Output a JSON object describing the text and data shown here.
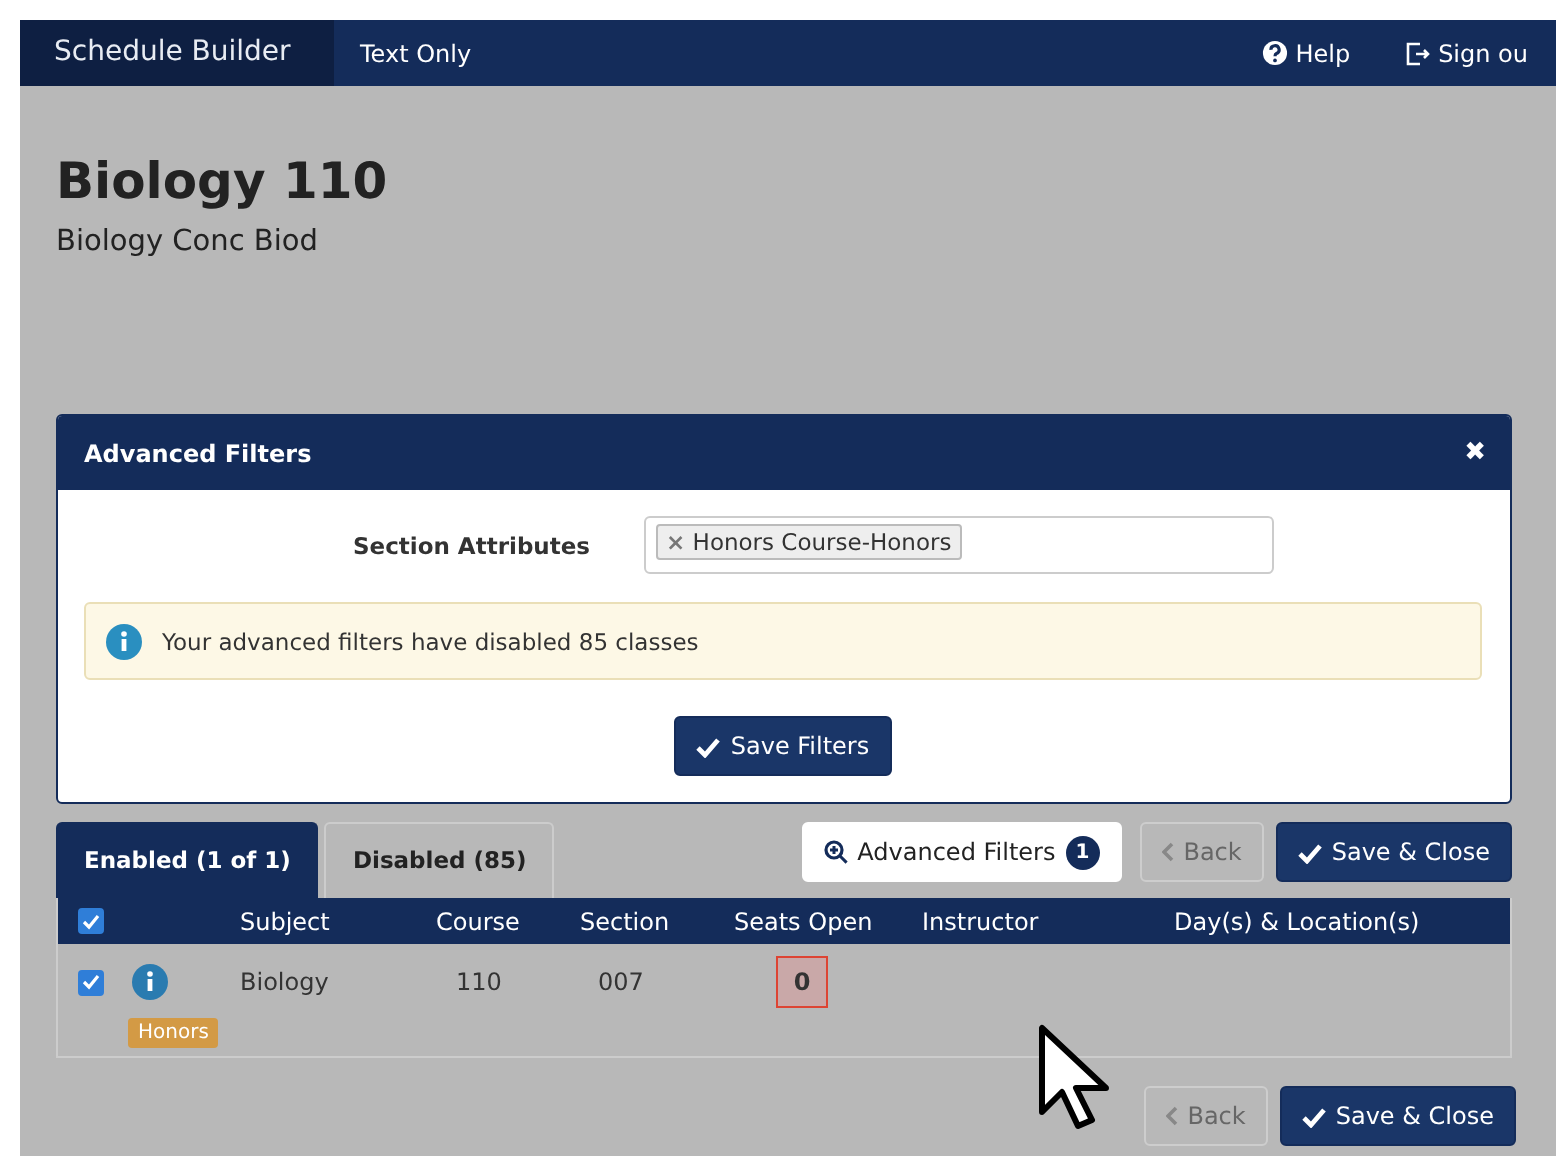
{
  "navbar": {
    "brand": "Schedule Builder",
    "links": [
      {
        "label": "Text Only"
      }
    ],
    "right_links": [
      {
        "label": "Help",
        "kind": "help"
      },
      {
        "label": "Sign ou",
        "kind": "signout"
      }
    ]
  },
  "course": {
    "title": "Biology 110",
    "subtitle": "Biology Conc Biod"
  },
  "modal": {
    "title": "Advanced Filters",
    "close": "✖",
    "field_label": "Section Attributes",
    "tags": [
      {
        "label": "Honors Course-Honors",
        "remove": "×"
      }
    ],
    "alert": "Your advanced filters have disabled 85 classes",
    "save_button": "Save Filters"
  },
  "tabs": [
    {
      "label": "Enabled (1 of 1)",
      "selected": true
    },
    {
      "label": "Disabled (85)",
      "selected": false
    }
  ],
  "toolbar": {
    "filters_button": "Advanced Filters",
    "filters_count": "1",
    "back_button": {
      "label": "Back",
      "disabled": true
    },
    "save_button": "Save & Close"
  },
  "table": {
    "select_all_checked": true,
    "columns": [
      "Subject",
      "Course",
      "Section",
      "Seats Open",
      "Instructor",
      "Day(s) & Location(s)"
    ],
    "rows": [
      {
        "checked": true,
        "subject": "Biology",
        "course": "110",
        "section": "007",
        "seats_open": "0",
        "seats_flagged": true,
        "tag": "Honors"
      }
    ]
  },
  "footer": {
    "back_button": {
      "label": "Back",
      "disabled": true
    },
    "save_button": "Save & Close"
  }
}
